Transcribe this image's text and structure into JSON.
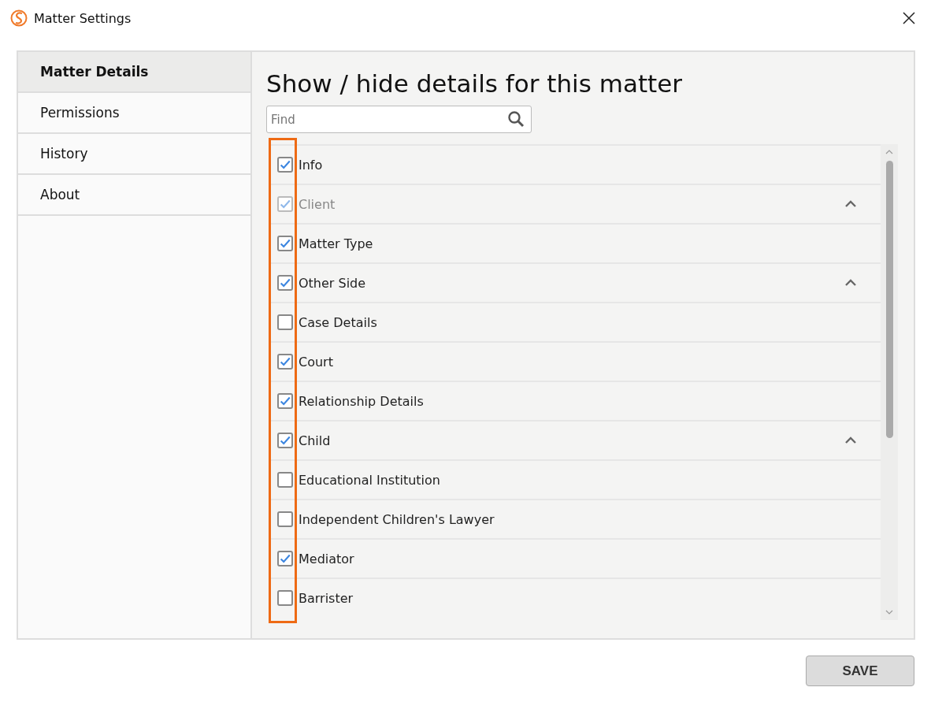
{
  "window": {
    "title": "Matter Settings"
  },
  "sidebar": {
    "items": [
      {
        "label": "Matter Details",
        "selected": true
      },
      {
        "label": "Permissions",
        "selected": false
      },
      {
        "label": "History",
        "selected": false
      },
      {
        "label": "About",
        "selected": false
      }
    ]
  },
  "heading": "Show / hide details for this matter",
  "search": {
    "placeholder": "Find"
  },
  "details": [
    {
      "label": "Info",
      "checked": true,
      "disabled": false,
      "kind": "item"
    },
    {
      "label": "Client",
      "checked": true,
      "disabled": true,
      "kind": "group",
      "expanded": true
    },
    {
      "label": "Matter Type",
      "checked": true,
      "disabled": false,
      "kind": "item"
    },
    {
      "label": "Other Side",
      "checked": true,
      "disabled": false,
      "kind": "group",
      "expanded": true
    },
    {
      "label": "Case Details",
      "checked": false,
      "disabled": false,
      "kind": "item"
    },
    {
      "label": "Court",
      "checked": true,
      "disabled": false,
      "kind": "item"
    },
    {
      "label": "Relationship Details",
      "checked": true,
      "disabled": false,
      "kind": "item"
    },
    {
      "label": "Child",
      "checked": true,
      "disabled": false,
      "kind": "group",
      "expanded": true
    },
    {
      "label": "Educational Institution",
      "checked": false,
      "disabled": false,
      "kind": "item"
    },
    {
      "label": "Independent Children's Lawyer",
      "checked": false,
      "disabled": false,
      "kind": "item"
    },
    {
      "label": "Mediator",
      "checked": true,
      "disabled": false,
      "kind": "item"
    },
    {
      "label": "Barrister",
      "checked": false,
      "disabled": false,
      "kind": "item"
    }
  ],
  "buttons": [
    "SAVE"
  ]
}
